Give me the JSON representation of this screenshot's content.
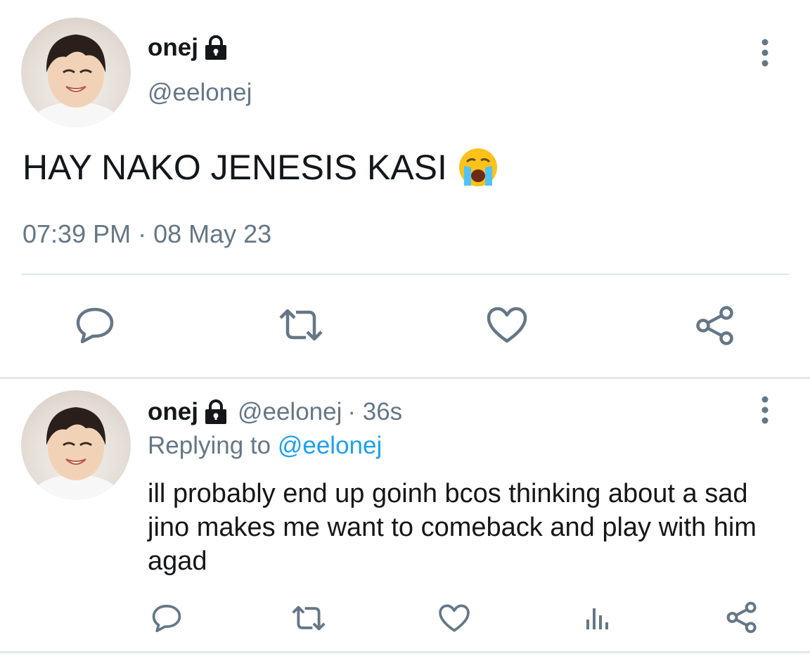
{
  "main_tweet": {
    "display_name": "onej",
    "handle": "@eelonej",
    "text": "HAY NAKO JENESIS KASI",
    "emoji": "😭",
    "timestamp": "07:39 PM · 08 May 23",
    "protected_icon": "lock-icon",
    "more_icon": "more-vertical-icon",
    "actions": [
      "reply-icon",
      "retweet-icon",
      "like-icon",
      "share-icon"
    ]
  },
  "reply_tweet": {
    "display_name": "onej",
    "handle": "@eelonej",
    "age": "· 36s",
    "replying_to_label": "Replying to",
    "replying_to_handle": "@eelonej",
    "text": "ill probably end up goinh bcos thinking about a sad jino makes me want to comeback and play with him agad",
    "protected_icon": "lock-icon",
    "more_icon": "more-vertical-icon",
    "actions": [
      "reply-icon",
      "retweet-icon",
      "like-icon",
      "analytics-icon",
      "share-icon"
    ]
  },
  "colors": {
    "text": "#14171a",
    "muted": "#657786",
    "link": "#1da1f2",
    "divider": "#e1e8ed",
    "icon": "#657786"
  }
}
